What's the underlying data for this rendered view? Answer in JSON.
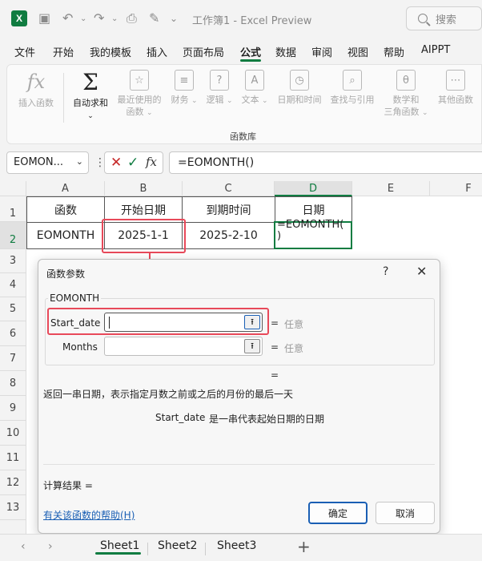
{
  "title": "工作簿1 - Excel Preview",
  "search": {
    "label": "搜索"
  },
  "menu": [
    "文件",
    "开始",
    "我的模板",
    "插入",
    "页面布局",
    "公式",
    "数据",
    "审阅",
    "视图",
    "帮助",
    "AIPPT"
  ],
  "ribbon": {
    "insert_function": "插入函数",
    "autosum": "自动求和",
    "recent": [
      "最近使用的",
      "函数"
    ],
    "finance": "财务",
    "logical": "逻辑",
    "text": "文本",
    "datetime": "日期和时间",
    "lookup": "查找与引用",
    "math": [
      "数学和",
      "三角函数"
    ],
    "other": "其他函数",
    "group_label": "函数库"
  },
  "formula_bar": {
    "name_box": "EOMON...",
    "formula": "=EOMONTH()"
  },
  "columns": [
    "A",
    "B",
    "C",
    "D",
    "E",
    "F"
  ],
  "rows": [
    "1",
    "2",
    "3",
    "4",
    "5",
    "6",
    "7",
    "8",
    "9",
    "10",
    "11",
    "12",
    "13"
  ],
  "cells": {
    "A1": "函数",
    "B1": "开始日期",
    "C1": "到期时间",
    "D1": "日期",
    "A2": "EOMONTH",
    "B2": "2025-1-1",
    "C2": "2025-2-10",
    "D2_line1": "=EOMONTH(",
    "D2_line2": ")"
  },
  "dialog": {
    "title": "函数参数",
    "help": "?",
    "close": "✕",
    "function_name": "EOMONTH",
    "args": [
      {
        "label": "Start_date",
        "eq": "=",
        "value": "任意"
      },
      {
        "label": "Months",
        "eq": "=",
        "value": "任意"
      }
    ],
    "result_eq": "=",
    "description": "返回一串日期，表示指定月数之前或之后的月份的最后一天",
    "arg_desc_name": "Start_date",
    "arg_desc": "是一串代表起始日期的日期",
    "calc_result": "计算结果 =",
    "help_link": "有关该函数的帮助(H)",
    "ok": "确定",
    "cancel": "取消"
  },
  "sheets": [
    "Sheet1",
    "Sheet2",
    "Sheet3"
  ],
  "colors": {
    "excel_green": "#107c41",
    "highlight_red": "#e8495a",
    "link_blue": "#1a5fb4"
  }
}
